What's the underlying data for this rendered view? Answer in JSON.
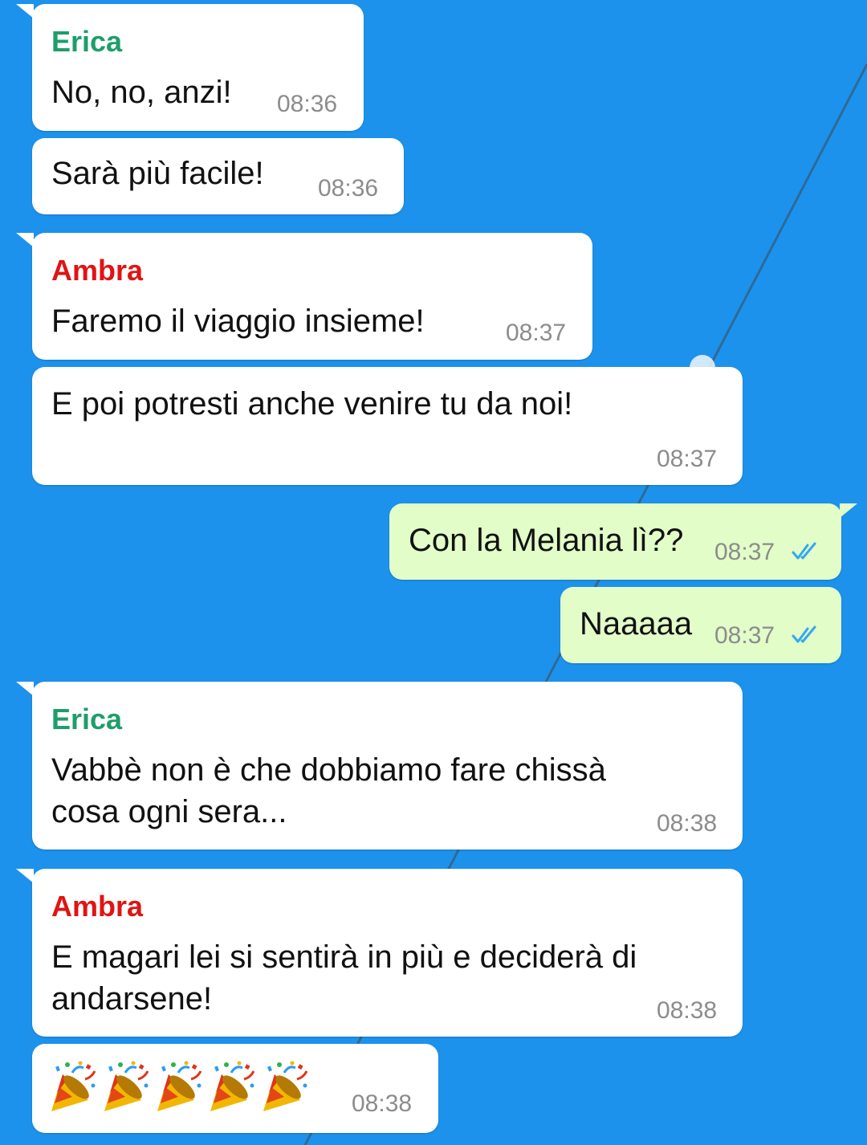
{
  "colors": {
    "background": "#1d92ec",
    "incoming_bubble": "#ffffff",
    "outgoing_bubble": "#e2fdc8",
    "erica": "#1e9e6a",
    "ambra": "#e01414",
    "read_ticks": "#34a8f0"
  },
  "messages": [
    {
      "sender": "Erica",
      "text": "No, no, anzi!",
      "time": "08:36"
    },
    {
      "text": "Sarà più facile!",
      "time": "08:36"
    },
    {
      "sender": "Ambra",
      "text": "Faremo il viaggio insieme!",
      "time": "08:37"
    },
    {
      "text": "E poi potresti anche venire tu da noi!",
      "time": "08:37"
    },
    {
      "text": "Con la Melania lì??",
      "time": "08:37",
      "status": "read"
    },
    {
      "text": "Naaaaa",
      "time": "08:37",
      "status": "read"
    },
    {
      "sender": "Erica",
      "text_lines": [
        "Vabbè non è che dobbiamo fare chissà",
        "cosa ogni sera..."
      ],
      "time": "08:38"
    },
    {
      "sender": "Ambra",
      "text_lines": [
        "E magari lei si sentirà in più e deciderà di",
        "andarsene!"
      ],
      "time": "08:38"
    },
    {
      "emoji": "party-popper-icon",
      "emoji_count": 5,
      "time": "08:38"
    }
  ]
}
